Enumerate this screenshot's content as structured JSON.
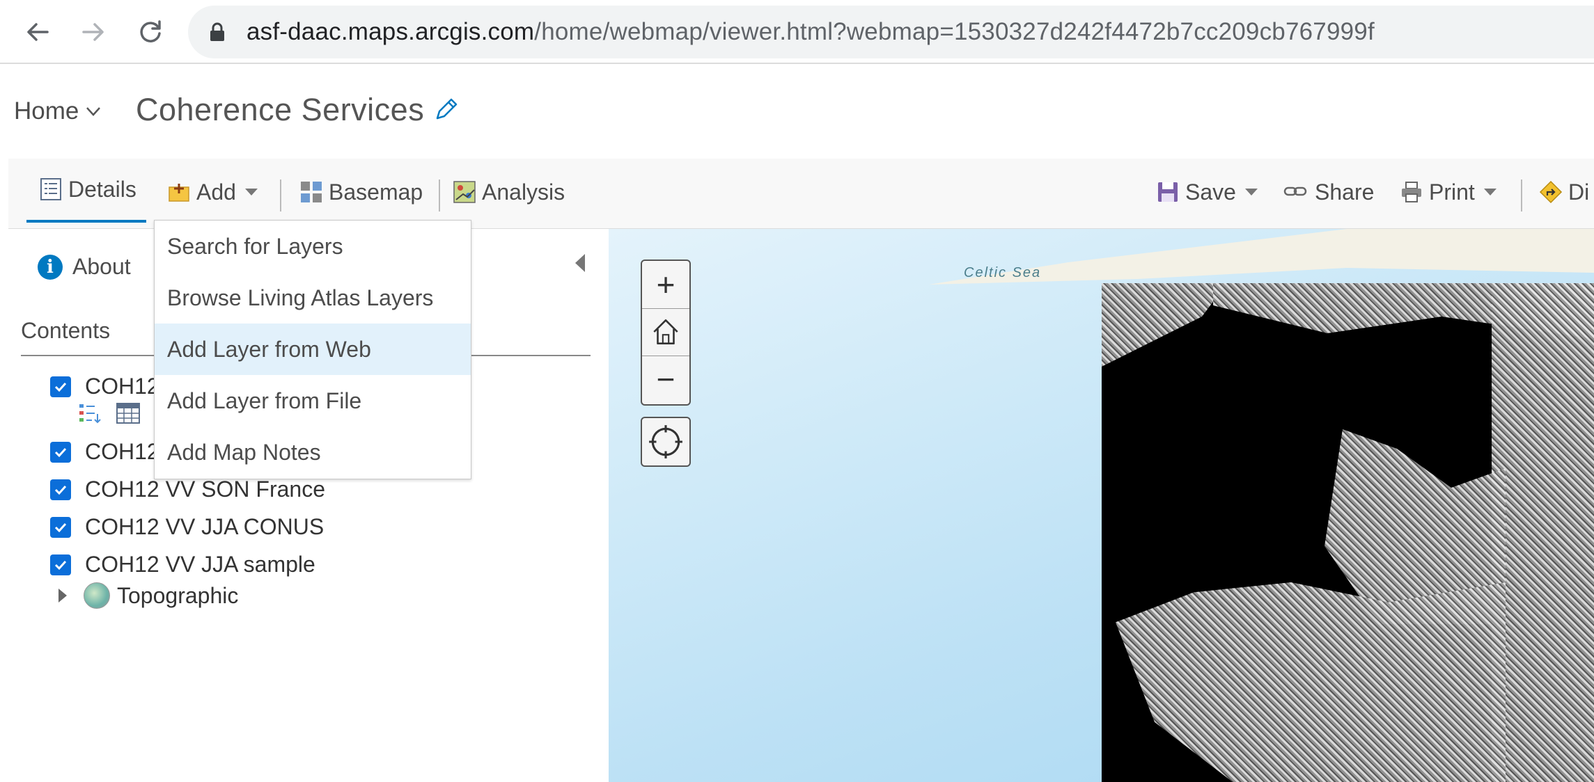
{
  "browser": {
    "url_host": "asf-daac.maps.arcgis.com",
    "url_path": "/home/webmap/viewer.html?webmap=1530327d242f4472b7cc209cb767999f",
    "icons": [
      "back-arrow-icon",
      "forward-arrow-icon",
      "reload-icon",
      "lock-icon"
    ]
  },
  "header": {
    "home_label": "Home",
    "title": "Coherence Services"
  },
  "toolbar": {
    "details": "Details",
    "add": "Add",
    "basemap": "Basemap",
    "analysis": "Analysis",
    "save": "Save",
    "share": "Share",
    "print": "Print",
    "directions_partial": "Di",
    "accent_color": "#0079c1"
  },
  "add_menu": {
    "items": [
      "Search for Layers",
      "Browse Living Atlas Layers",
      "Add Layer from Web",
      "Add Layer from File",
      "Add Map Notes"
    ],
    "hovered": "Add Layer from Web"
  },
  "side_panel": {
    "about": "About",
    "contents": "Contents",
    "layers": [
      {
        "label": "COH12",
        "checked": true
      },
      {
        "label": "COH12",
        "checked": true
      },
      {
        "label": "COH12 VV SON France",
        "checked": true
      },
      {
        "label": "COH12 VV JJA CONUS",
        "checked": true
      },
      {
        "label": "COH12 VV JJA sample",
        "checked": true
      }
    ],
    "basemap_layer": "Topographic"
  },
  "map": {
    "sea_label": "Celtic Sea",
    "zoom_in": "+",
    "zoom_out": "−"
  }
}
